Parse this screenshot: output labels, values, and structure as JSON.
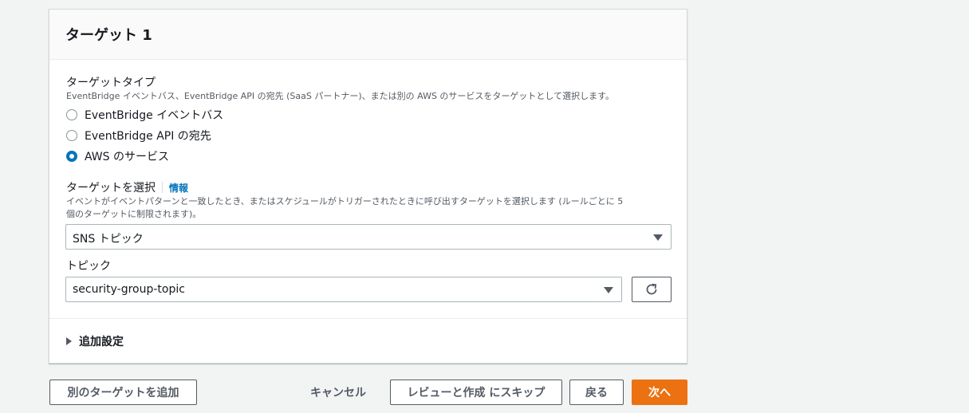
{
  "panel": {
    "title": "ターゲット 1",
    "target_type": {
      "label": "ターゲットタイプ",
      "description": "EventBridge イベントバス、EventBridge API の宛先 (SaaS パートナー)、または別の AWS のサービスをターゲットとして選択します。",
      "options": [
        {
          "label": "EventBridge イベントバス",
          "checked": false
        },
        {
          "label": "EventBridge API の宛先",
          "checked": false
        },
        {
          "label": "AWS のサービス",
          "checked": true
        }
      ]
    },
    "select_target": {
      "label": "ターゲットを選択",
      "info_link": "情報",
      "description_line1": "イベントがイベントパターンと一致したとき、またはスケジュールがトリガーされたときに呼び出すターゲットを選択します (ルールごとに 5",
      "description_line2": "個のターゲットに制限されます)。",
      "value": "SNS トピック"
    },
    "topic": {
      "label": "トピック",
      "value": "security-group-topic"
    },
    "additional_settings": "追加設定"
  },
  "footer": {
    "add_target": "別のターゲットを追加",
    "cancel": "キャンセル",
    "skip_to_review": "レビューと作成 にスキップ",
    "back": "戻る",
    "next": "次へ"
  },
  "colors": {
    "primary": "#ec7211",
    "link": "#0073bb",
    "radio_selected": "#0073bb"
  }
}
